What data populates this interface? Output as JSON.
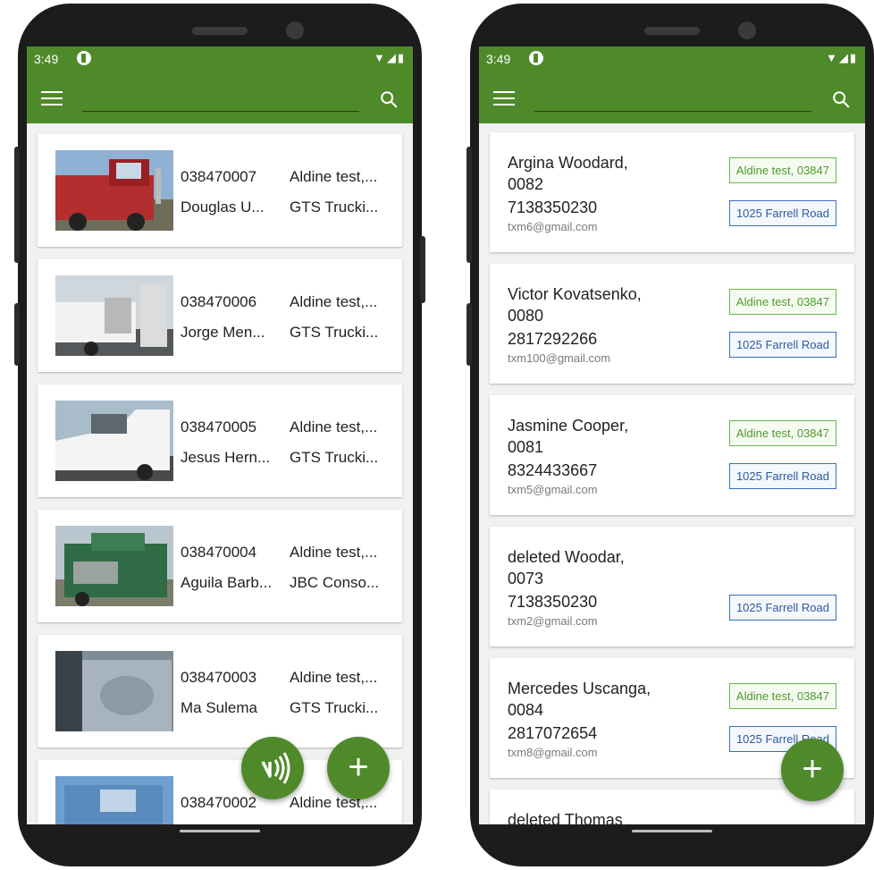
{
  "left_phone": {
    "status": {
      "time": "3:49"
    },
    "rows": [
      {
        "id": "038470007",
        "location": "Aldine test,...",
        "driver": "Douglas U...",
        "company": "GTS Trucki..."
      },
      {
        "id": "038470006",
        "location": "Aldine test,...",
        "driver": "Jorge Men...",
        "company": "GTS Trucki..."
      },
      {
        "id": "038470005",
        "location": "Aldine test,...",
        "driver": "Jesus Hern...",
        "company": "GTS Trucki..."
      },
      {
        "id": "038470004",
        "location": "Aldine test,...",
        "driver": "Aguila Barb...",
        "company": "JBC Conso..."
      },
      {
        "id": "038470003",
        "location": "Aldine test,...",
        "driver": "Ma Sulema",
        "company": "GTS Trucki..."
      },
      {
        "id": "038470002",
        "location": "Aldine test,...",
        "driver": "",
        "company": ""
      }
    ],
    "nfc_fab_icon": "nfc-icon",
    "add_fab_label": "+"
  },
  "right_phone": {
    "status": {
      "time": "3:49"
    },
    "contacts": [
      {
        "name": "Argina Woodard,",
        "code": "0082",
        "phone": "7138350230",
        "email": "txm6@gmail.com",
        "tag_location": "Aldine test, 03847",
        "tag_address": "1025 Farrell Road"
      },
      {
        "name": "Victor Kovatsenko,",
        "code": "0080",
        "phone": "2817292266",
        "email": "txm100@gmail.com",
        "tag_location": "Aldine test, 03847",
        "tag_address": "1025 Farrell Road"
      },
      {
        "name": "Jasmine Cooper,",
        "code": "0081",
        "phone": "8324433667",
        "email": "txm5@gmail.com",
        "tag_location": "Aldine test, 03847",
        "tag_address": "1025 Farrell Road"
      },
      {
        "name": "deleted Woodar,",
        "code": "0073",
        "phone": "7138350230",
        "email": "txm2@gmail.com",
        "tag_location": "",
        "tag_address": "1025 Farrell Road"
      },
      {
        "name": "Mercedes Uscanga,",
        "code": "0084",
        "phone": "2817072654",
        "email": "txm8@gmail.com",
        "tag_location": "Aldine test, 03847",
        "tag_address": "1025 Farrell Road"
      },
      {
        "name": "deleted Thomas",
        "code": "",
        "phone": "",
        "email": "",
        "tag_location": "",
        "tag_address": ""
      }
    ],
    "add_fab_label": "+"
  },
  "colors": {
    "primary": "#4f8a2a",
    "tag_green": "#4e9a2a",
    "tag_blue": "#2c5aa0"
  }
}
